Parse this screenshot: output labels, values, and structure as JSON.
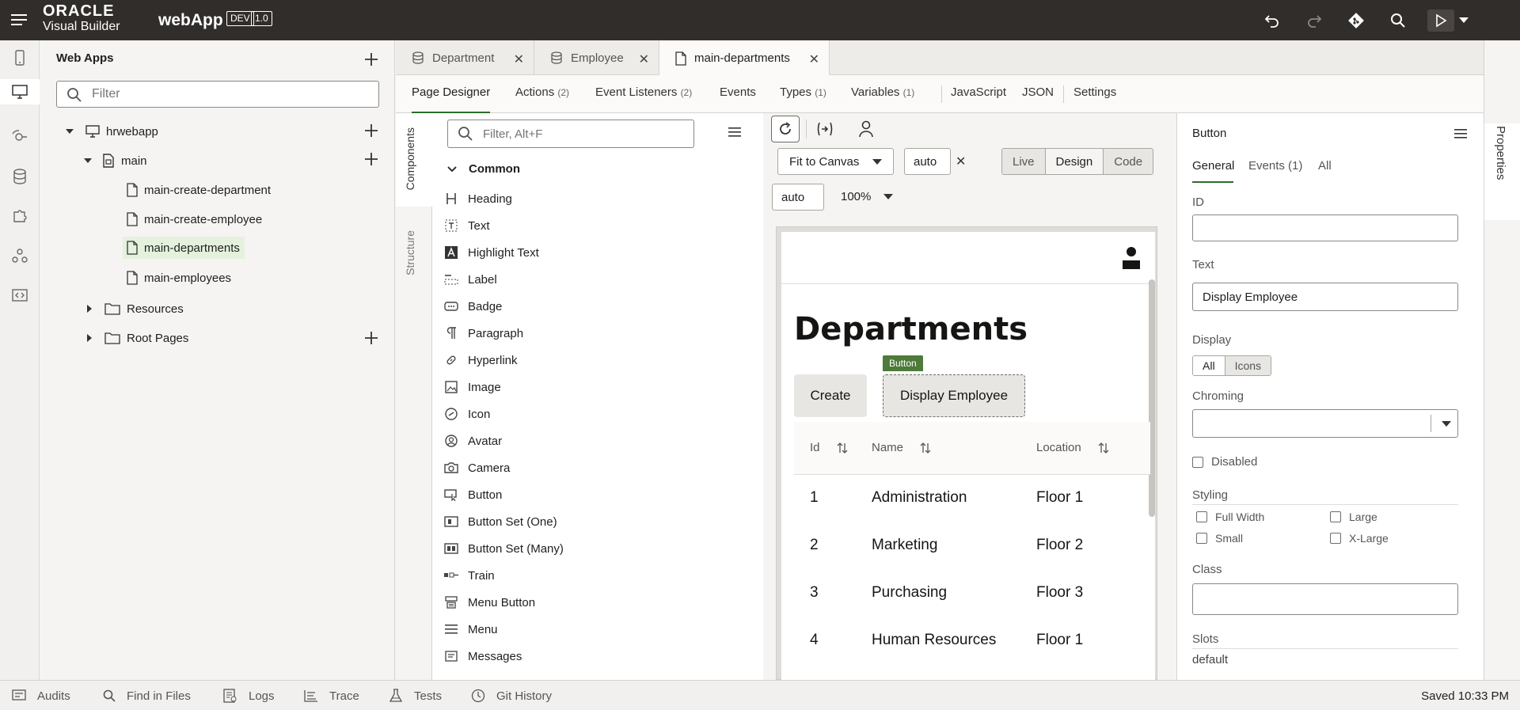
{
  "topbar": {
    "brand_line1": "ORACLE",
    "brand_line2": "Visual Builder",
    "app_name": "webApp",
    "env_badge": "DEV",
    "version_badge": "1.0"
  },
  "navigator": {
    "title": "Web Apps",
    "filter_placeholder": "Filter",
    "tree": {
      "app": "hrwebapp",
      "flow": "main",
      "pages": [
        "main-create-department",
        "main-create-employee",
        "main-departments",
        "main-employees"
      ],
      "resources": "Resources",
      "root_pages": "Root Pages"
    }
  },
  "tabs": [
    {
      "label": "Department"
    },
    {
      "label": "Employee"
    },
    {
      "label": "main-departments"
    }
  ],
  "subtabs": {
    "page_designer": "Page Designer",
    "actions": "Actions",
    "actions_count": "(2)",
    "event_listeners": "Event Listeners",
    "event_listeners_count": "(2)",
    "events": "Events",
    "types": "Types",
    "types_count": "(1)",
    "variables": "Variables",
    "variables_count": "(1)",
    "javascript": "JavaScript",
    "json": "JSON",
    "settings": "Settings"
  },
  "vertical_tabs": {
    "components": "Components",
    "structure": "Structure"
  },
  "palette": {
    "filter_placeholder": "Filter, Alt+F",
    "group": "Common",
    "items": [
      "Heading",
      "Text",
      "Highlight Text",
      "Label",
      "Badge",
      "Paragraph",
      "Hyperlink",
      "Image",
      "Icon",
      "Avatar",
      "Camera",
      "Button",
      "Button Set (One)",
      "Button Set (Many)",
      "Train",
      "Menu Button",
      "Menu",
      "Messages"
    ]
  },
  "canvas_toolbar": {
    "fit": "Fit to Canvas",
    "width": "auto",
    "height": "auto",
    "zoom": "100%",
    "mode_live": "Live",
    "mode_design": "Design",
    "mode_code": "Code"
  },
  "preview": {
    "title": "Departments",
    "create_button": "Create",
    "display_button": "Display Employee",
    "selected_tag": "Button",
    "columns": [
      "Id",
      "Name",
      "Location"
    ],
    "rows": [
      [
        "1",
        "Administration",
        "Floor 1"
      ],
      [
        "2",
        "Marketing",
        "Floor 2"
      ],
      [
        "3",
        "Purchasing",
        "Floor 3"
      ],
      [
        "4",
        "Human Resources",
        "Floor 1"
      ]
    ]
  },
  "properties": {
    "component": "Button",
    "tab_general": "General",
    "tab_events": "Events (1)",
    "tab_all": "All",
    "id_label": "ID",
    "id_value": "",
    "text_label": "Text",
    "text_value": "Display Employee",
    "display_label": "Display",
    "display_all": "All",
    "display_icons": "Icons",
    "chroming_label": "Chroming",
    "disabled_label": "Disabled",
    "styling_label": "Styling",
    "full_width": "Full Width",
    "large": "Large",
    "small": "Small",
    "xlarge": "X-Large",
    "class_label": "Class",
    "slots_label": "Slots",
    "slots_value": "default",
    "side_tab": "Properties"
  },
  "statusbar": {
    "audits": "Audits",
    "find": "Find in Files",
    "logs": "Logs",
    "trace": "Trace",
    "tests": "Tests",
    "git": "Git History",
    "saved": "Saved 10:33 PM"
  },
  "colors": {
    "topbar": "#312d2a",
    "accent_green": "#2c6e2a",
    "selection_tag": "#4e7a3a",
    "selected_node": "#e4f2dd"
  }
}
